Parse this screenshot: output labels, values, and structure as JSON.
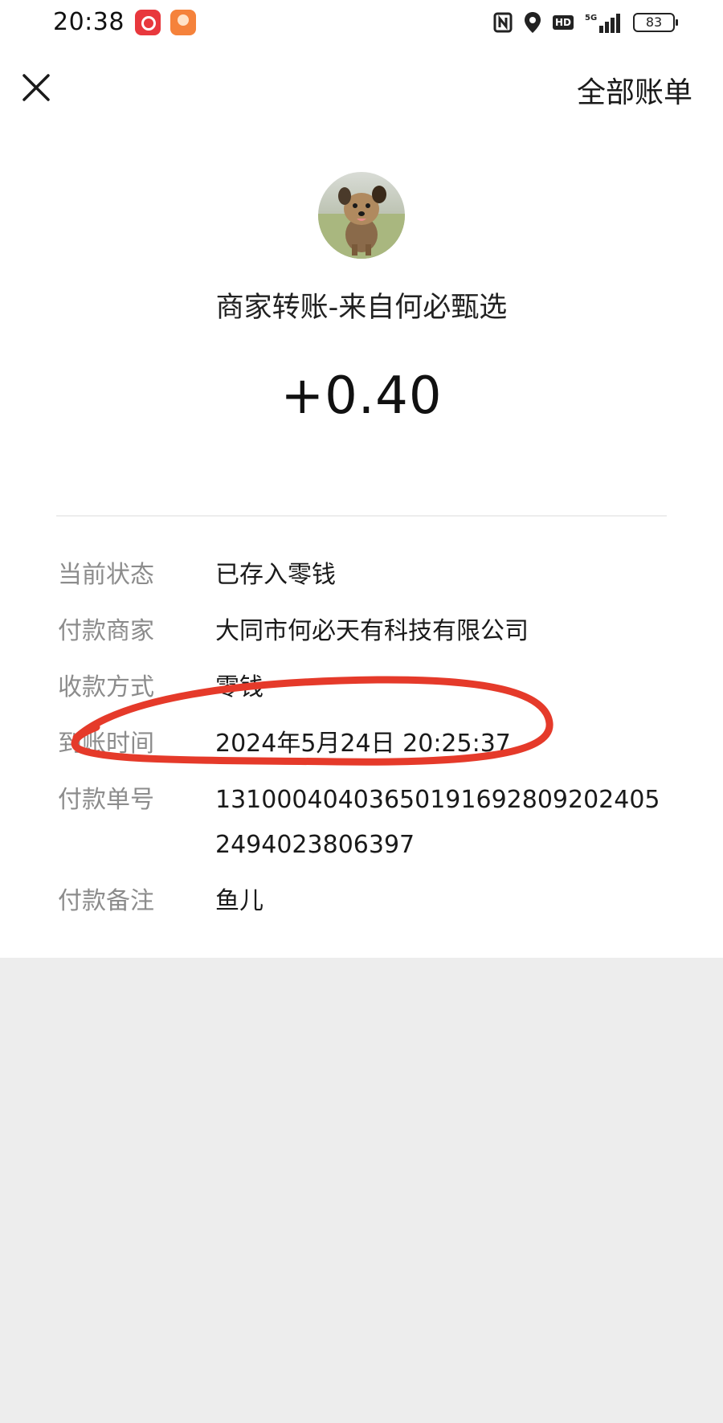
{
  "status_bar": {
    "time": "20:38",
    "battery": "83",
    "network": "5G",
    "hd": "HD"
  },
  "header": {
    "all_bills_label": "全部账单",
    "close_icon": "close-icon"
  },
  "transaction": {
    "title": "商家转账-来自何必甄选",
    "amount": "+0.40",
    "details": [
      {
        "label": "当前状态",
        "value": "已存入零钱"
      },
      {
        "label": "付款商家",
        "value": "大同市何必天有科技有限公司"
      },
      {
        "label": "收款方式",
        "value": "零钱"
      },
      {
        "label": "到账时间",
        "value": "2024年5月24日 20:25:37"
      },
      {
        "label": "付款单号",
        "value": "131000404036501916928092024052494023806397"
      },
      {
        "label": "付款备注",
        "value": "鱼儿"
      }
    ]
  },
  "colors": {
    "annotation": "#e53a2a",
    "background": "#ededed",
    "card": "#ffffff",
    "label": "#8c8c8c"
  }
}
